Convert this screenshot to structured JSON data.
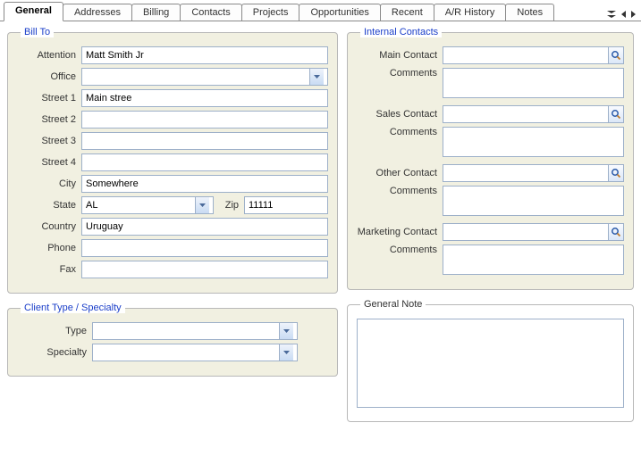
{
  "tabs": {
    "items": [
      "General",
      "Addresses",
      "Billing",
      "Contacts",
      "Projects",
      "Opportunities",
      "Recent",
      "A/R History",
      "Notes"
    ],
    "active": 0
  },
  "billTo": {
    "legend": "Bill To",
    "attention_label": "Attention",
    "attention": "Matt Smith Jr",
    "office_label": "Office",
    "office": "",
    "street1_label": "Street 1",
    "street1": "Main stree",
    "street2_label": "Street 2",
    "street2": "",
    "street3_label": "Street 3",
    "street3": "",
    "street4_label": "Street 4",
    "street4": "",
    "city_label": "City",
    "city": "Somewhere",
    "state_label": "State",
    "state": "AL",
    "zip_label": "Zip",
    "zip": "11111",
    "country_label": "Country",
    "country": "Uruguay",
    "phone_label": "Phone",
    "phone": "",
    "fax_label": "Fax",
    "fax": ""
  },
  "clientType": {
    "legend": "Client Type / Specialty",
    "type_label": "Type",
    "type": "",
    "specialty_label": "Specialty",
    "specialty": ""
  },
  "internal": {
    "legend": "Internal Contacts",
    "main_label": "Main Contact",
    "main": "",
    "main_comments_label": "Comments",
    "main_comments": "",
    "sales_label": "Sales Contact",
    "sales": "",
    "sales_comments_label": "Comments",
    "sales_comments": "",
    "other_label": "Other Contact",
    "other": "",
    "other_comments_label": "Comments",
    "other_comments": "",
    "marketing_label": "Marketing Contact",
    "marketing": "",
    "marketing_comments_label": "Comments",
    "marketing_comments": ""
  },
  "generalNote": {
    "legend": "General Note",
    "value": ""
  }
}
